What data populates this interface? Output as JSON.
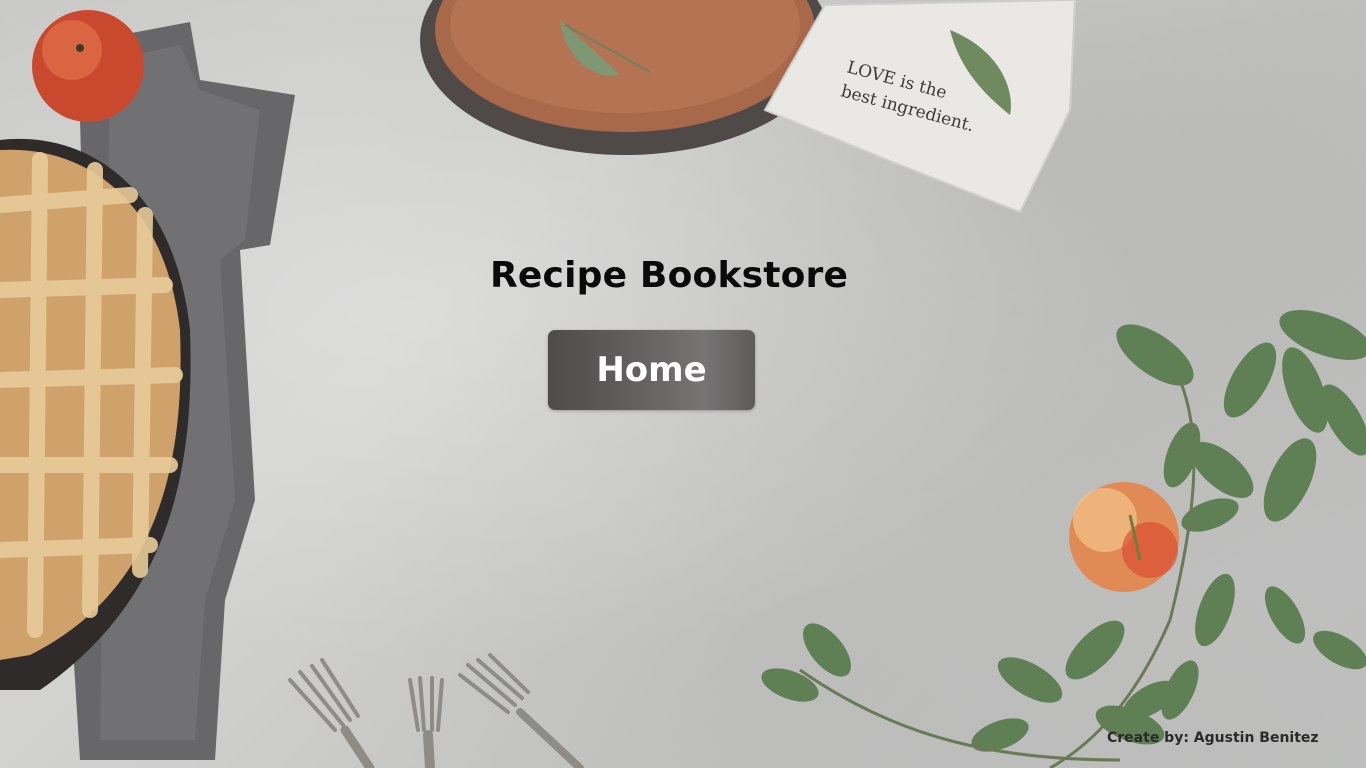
{
  "page": {
    "title": "Recipe Bookstore"
  },
  "nav": {
    "home_label": "Home"
  },
  "footer": {
    "credit": "Create by: Agustin Benitez"
  },
  "decor": {
    "napkin_text_line1": "LOVE is the",
    "napkin_text_line2": "best ingredient."
  },
  "colors": {
    "background": "#c9c9c7",
    "button": "#5e5d5c",
    "title": "#0a0a0a",
    "button_text": "#ffffff"
  }
}
